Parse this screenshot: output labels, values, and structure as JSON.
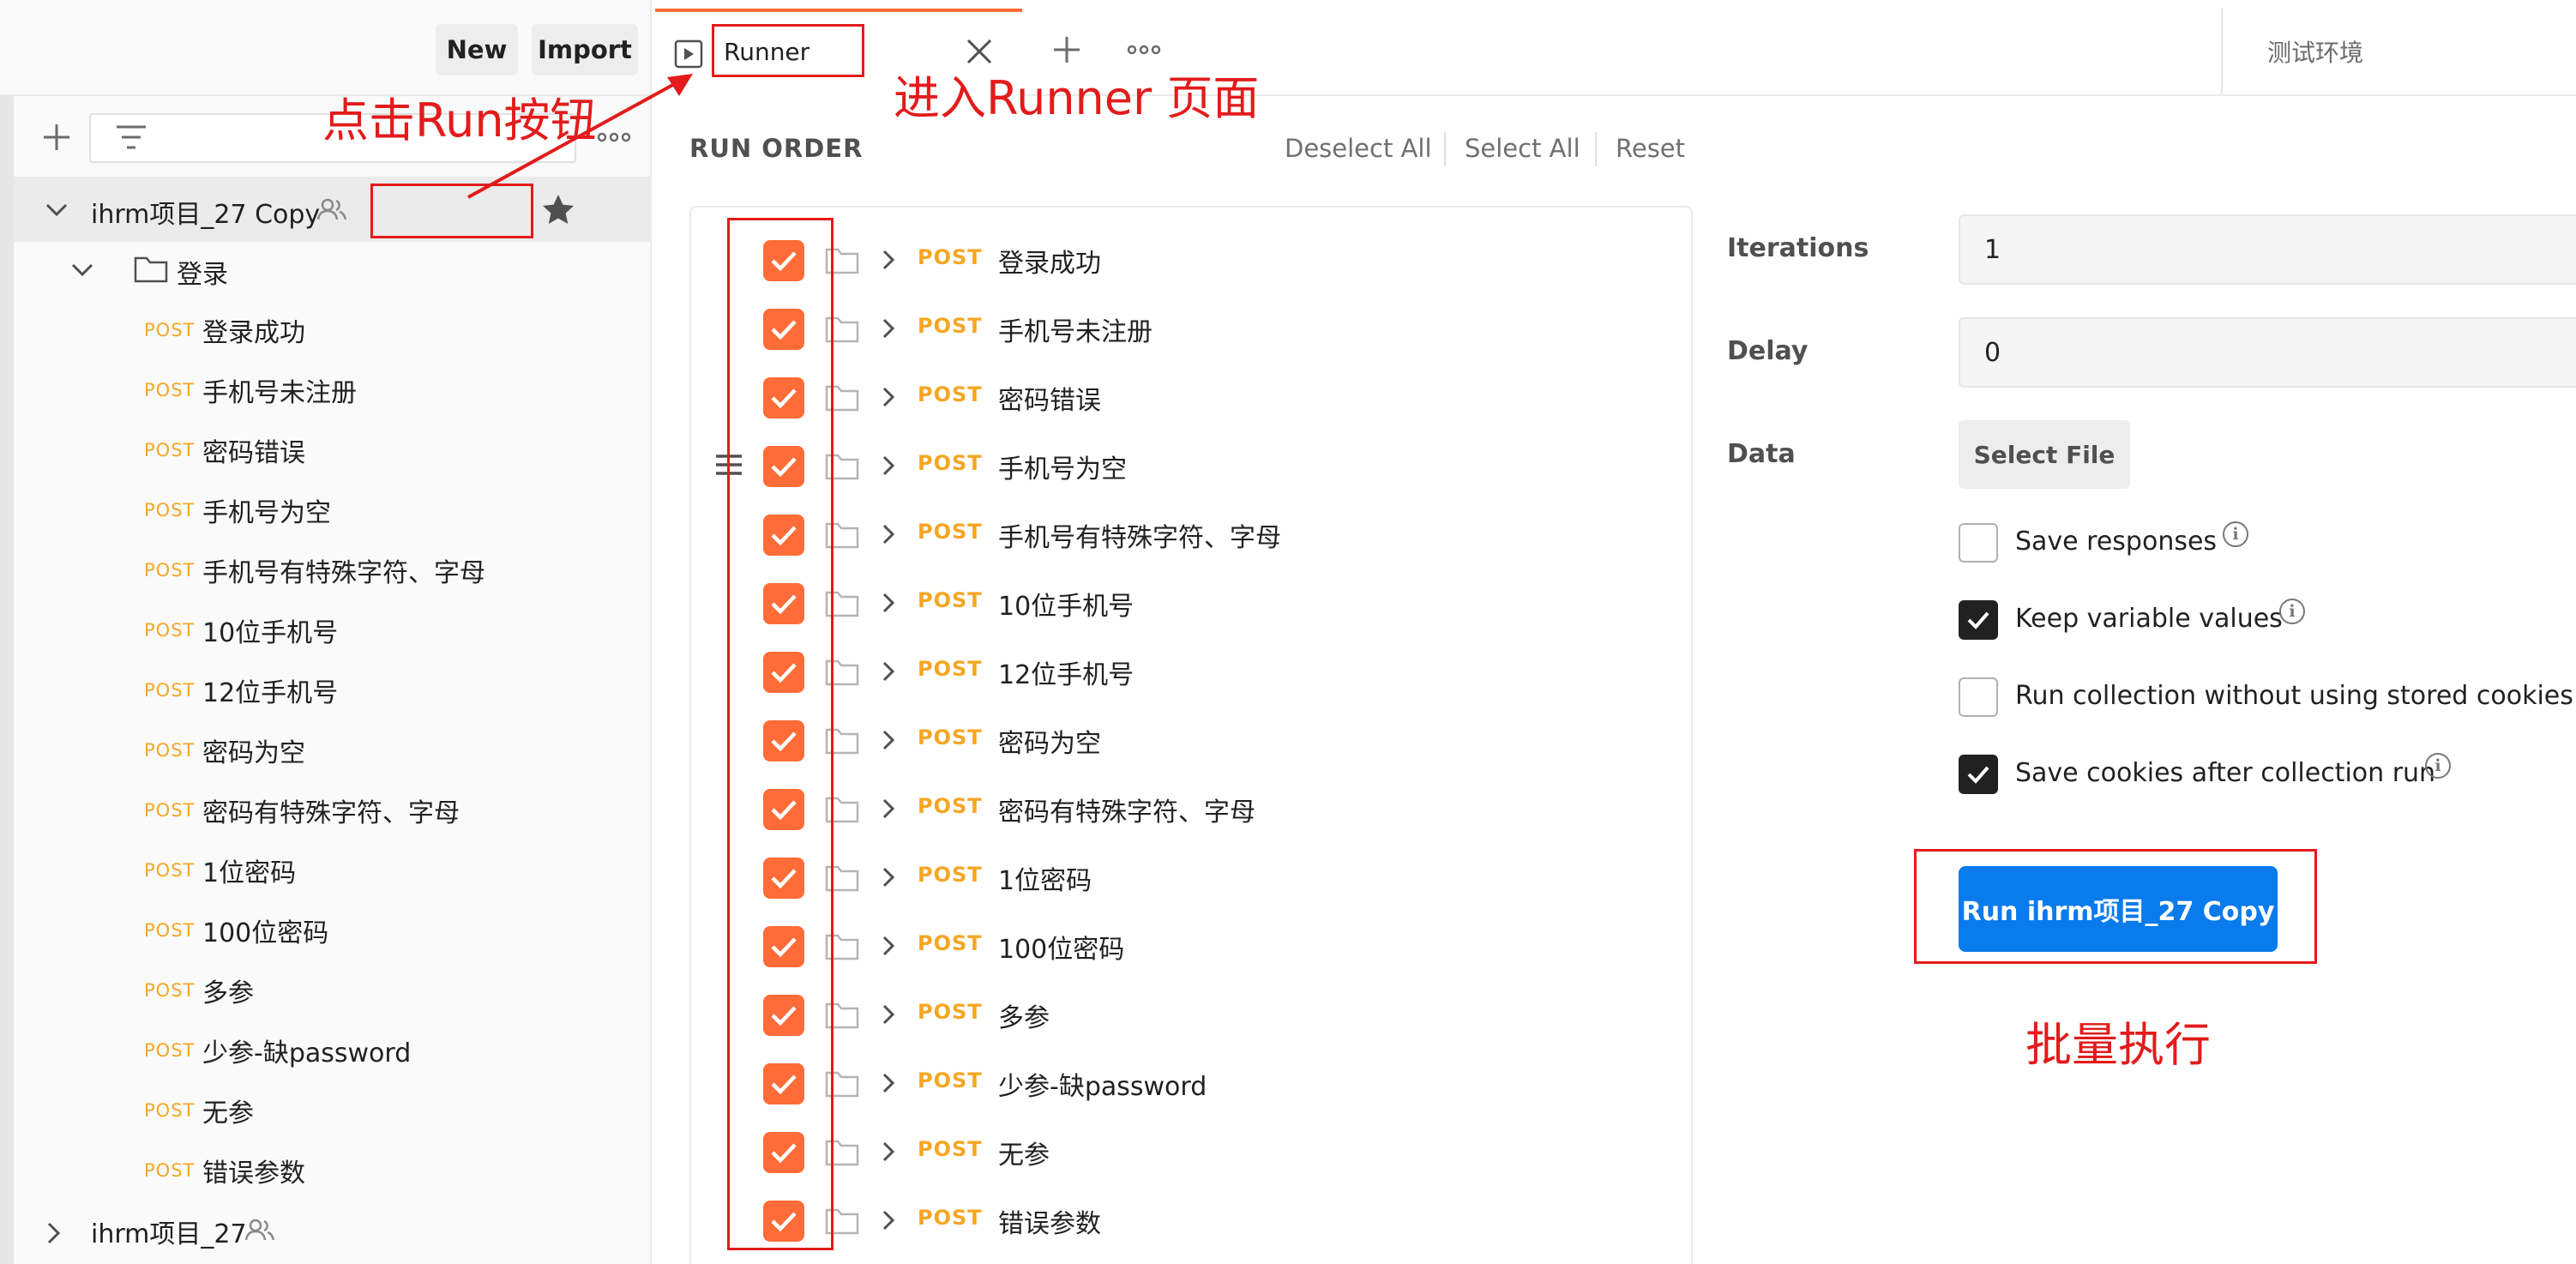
{
  "sidebar": {
    "new_label": "New",
    "import_label": "Import",
    "collection_name": "ihrm项目_27 Copy",
    "folder_name": "登录",
    "method": "POST",
    "requests": [
      "登录成功",
      "手机号未注册",
      "密码错误",
      "手机号为空",
      "手机号有特殊字符、字母",
      "10位手机号",
      "12位手机号",
      "密码为空",
      "密码有特殊字符、字母",
      "1位密码",
      "100位密码",
      "多参",
      "少参-缺password",
      "无参",
      "错误参数"
    ],
    "collection2_name": "ihrm项目_27"
  },
  "tabs": {
    "active_tab_label": "Runner",
    "environment_label": "测试环境"
  },
  "run_order": {
    "title": "RUN ORDER",
    "deselect_all": "Deselect All",
    "select_all": "Select All",
    "reset": "Reset",
    "method": "POST",
    "items": [
      "登录成功",
      "手机号未注册",
      "密码错误",
      "手机号为空",
      "手机号有特殊字符、字母",
      "10位手机号",
      "12位手机号",
      "密码为空",
      "密码有特殊字符、字母",
      "1位密码",
      "100位密码",
      "多参",
      "少参-缺password",
      "无参",
      "错误参数"
    ]
  },
  "settings": {
    "iterations_label": "Iterations",
    "iterations_value": "1",
    "delay_label": "Delay",
    "delay_value": "0",
    "data_label": "Data",
    "select_file_label": "Select File",
    "options": [
      {
        "label": "Save responses",
        "checked": false,
        "info": true
      },
      {
        "label": "Keep variable values",
        "checked": true,
        "info": true
      },
      {
        "label": "Run collection without using stored cookies",
        "checked": false,
        "info": false
      },
      {
        "label": "Save cookies after collection run",
        "checked": true,
        "info": true
      }
    ],
    "run_button_label": "Run ihrm项目_27 Copy"
  },
  "annotations": {
    "click_run": "点击Run按钮",
    "enter_runner": "进入Runner 页面",
    "batch_run": "批量执行"
  },
  "colors": {
    "accent": "#ff6c37",
    "method_post": "#f5a623",
    "run_button": "#097bed",
    "annotation": "#e31b1b"
  }
}
